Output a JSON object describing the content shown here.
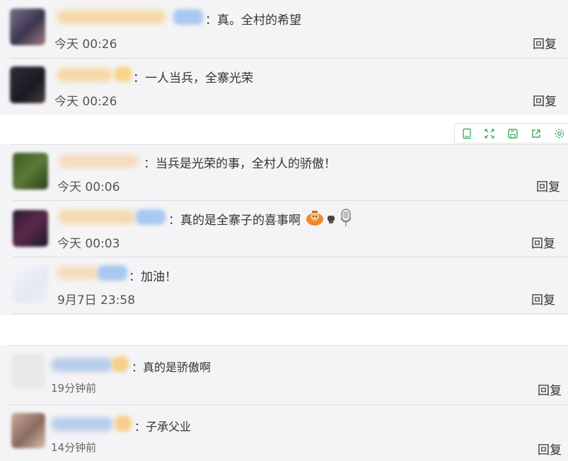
{
  "section1": [
    {
      "comment": "：真。全村的希望",
      "time": "今天 00:26",
      "reply": "回复"
    },
    {
      "comment": "：一人当兵，全寨光荣",
      "time": "今天 00:26",
      "reply": "回复"
    }
  ],
  "toolbar": {
    "icons": [
      "page-icon",
      "expand-icon",
      "save-icon",
      "share-icon",
      "settings-icon"
    ],
    "accent": "#3fae5c"
  },
  "section2": [
    {
      "comment": "：当兵是光荣的事，全村人的骄傲！",
      "time": "今天 00:06",
      "reply": "回复"
    },
    {
      "comment": "：真的是全寨子的喜事啊",
      "time": "今天 00:03",
      "reply": "回复"
    },
    {
      "comment": "：加油！",
      "time": "9月7日 23:58",
      "reply": "回复"
    }
  ],
  "section3": [
    {
      "comment": "：真的是骄傲啊",
      "time": "19分钟前",
      "reply": "回复"
    },
    {
      "comment": "：子承父业",
      "time": "14分钟前",
      "reply": "回复"
    }
  ]
}
